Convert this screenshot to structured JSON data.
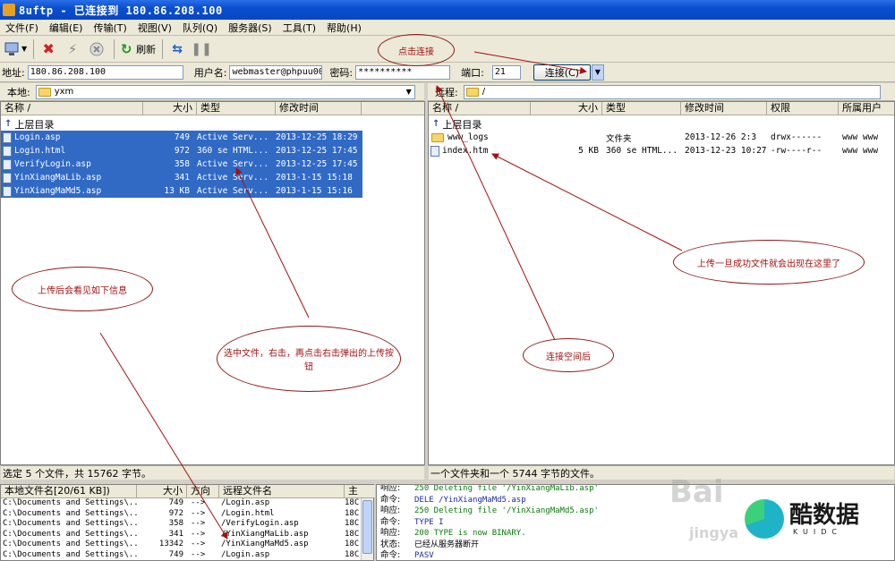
{
  "window": {
    "title": "8uftp - 已连接到 180.86.208.100"
  },
  "menu": [
    "文件(F)",
    "编辑(E)",
    "传输(T)",
    "视图(V)",
    "队列(Q)",
    "服务器(S)",
    "工具(T)",
    "帮助(H)"
  ],
  "toolbar": {
    "refresh_label": "刷新"
  },
  "connection": {
    "address_label": "地址:",
    "address_value": "180.86.208.100",
    "user_label": "用户名:",
    "user_value": "webmaster@phpuu009.",
    "password_label": "密码:",
    "password_value": "**********",
    "port_label": "端口:",
    "port_value": "21",
    "connect_label": "连接(C)"
  },
  "local": {
    "label": "本地:",
    "path": "yxm",
    "columns": [
      "名称 /",
      "大小",
      "类型",
      "修改时间"
    ],
    "up_label": "上层目录",
    "files": [
      {
        "name": "Login.asp",
        "size": "749",
        "type": "Active Serv...",
        "modified": "2013-12-25 18:29"
      },
      {
        "name": "Login.html",
        "size": "972",
        "type": "360 se HTML...",
        "modified": "2013-12-25 17:45"
      },
      {
        "name": "VerifyLogin.asp",
        "size": "358",
        "type": "Active Serv...",
        "modified": "2013-12-25 17:45"
      },
      {
        "name": "YinXiangMaLib.asp",
        "size": "341",
        "type": "Active Serv...",
        "modified": "2013-1-15 15:18"
      },
      {
        "name": "YinXiangMaMd5.asp",
        "size": "13 KB",
        "type": "Active Serv...",
        "modified": "2013-1-15 15:16"
      }
    ],
    "status": "选定 5 个文件，共 15762 字节。"
  },
  "remote": {
    "label": "远程:",
    "path": "/",
    "columns": [
      "名称 /",
      "大小",
      "类型",
      "修改时间",
      "权限",
      "所属用户"
    ],
    "up_label": "上层目录",
    "files": [
      {
        "name": "www_logs",
        "size": "",
        "type": "文件夹",
        "modified": "2013-12-26 2:3",
        "perm": "drwx------",
        "owner": "www www",
        "folder": true
      },
      {
        "name": "index.htm",
        "size": "5 KB",
        "type": "360 se HTML...",
        "modified": "2013-12-23 10:27",
        "perm": "-rw----r--",
        "owner": "www www",
        "folder": false
      }
    ],
    "status": "一个文件夹和一个 5744 字节的文件。"
  },
  "queue": {
    "columns": [
      "本地文件名[20/61 KB])",
      "大小",
      "方向",
      "远程文件名",
      "主"
    ],
    "rows": [
      {
        "local": "C:\\Documents and Settings\\...",
        "size": "749",
        "dir": "-->",
        "remote": "/Login.asp",
        "tail": "18C"
      },
      {
        "local": "C:\\Documents and Settings\\...",
        "size": "972",
        "dir": "-->",
        "remote": "/Login.html",
        "tail": "18C"
      },
      {
        "local": "C:\\Documents and Settings\\...",
        "size": "358",
        "dir": "-->",
        "remote": "/VerifyLogin.asp",
        "tail": "18C"
      },
      {
        "local": "C:\\Documents and Settings\\...",
        "size": "341",
        "dir": "-->",
        "remote": "/YinXiangMaLib.asp",
        "tail": "18C"
      },
      {
        "local": "C:\\Documents and Settings\\...",
        "size": "13342",
        "dir": "-->",
        "remote": "/YinXiangMaMd5.asp",
        "tail": "18C"
      },
      {
        "local": "C:\\Documents and Settings\\...",
        "size": "749",
        "dir": "-->",
        "remote": "/Login.asp",
        "tail": "18C"
      }
    ]
  },
  "log": [
    {
      "k": "响应:",
      "v": "250 Deleting file '/YinXiangMaLib.asp'",
      "c": "green"
    },
    {
      "k": "命令:",
      "v": "DELE /YinXiangMaMd5.asp",
      "c": "blue"
    },
    {
      "k": "响应:",
      "v": "250 Deleting file '/YinXiangMaMd5.asp'",
      "c": "green"
    },
    {
      "k": "命令:",
      "v": "TYPE I",
      "c": "blue"
    },
    {
      "k": "响应:",
      "v": "200 TYPE is now BINARY.",
      "c": "green"
    },
    {
      "k": "状态:",
      "v": "已经从服务器断开",
      "c": "black"
    },
    {
      "k": "命令:",
      "v": "PASV",
      "c": "blue"
    }
  ],
  "annotations": {
    "click_connect": "点击连接",
    "after_upload_info": "上传后会看见如下信息",
    "select_upload": "选中文件，右击，再点击右击弹出的上传按钮",
    "upload_success": "上传一旦成功文件就会出现在这里了",
    "remote_after": "连接空间后"
  },
  "watermark": {
    "baidu": "Bai",
    "jingyan": "jingya",
    "brand_name": "酷数据",
    "brand_sub": "KUIDC"
  },
  "colors": {
    "selection": "#316ac5",
    "annotation": "#a11212",
    "titlebar": "#0a4fcf"
  }
}
